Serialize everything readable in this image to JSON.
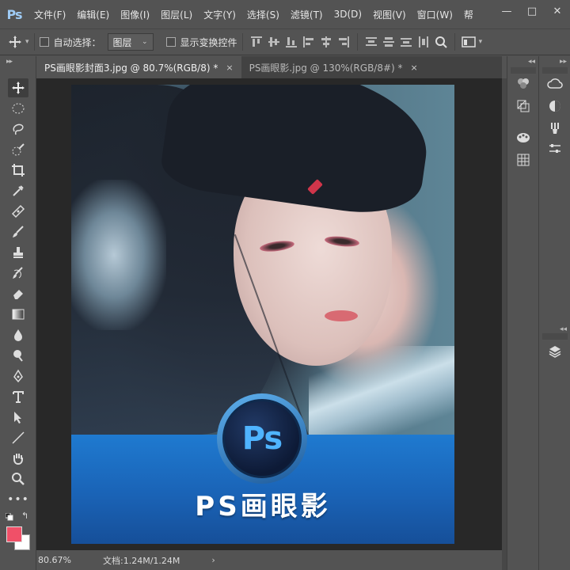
{
  "app": {
    "logo": "Ps"
  },
  "menu": {
    "items": [
      "文件(F)",
      "编辑(E)",
      "图像(I)",
      "图层(L)",
      "文字(Y)",
      "选择(S)",
      "滤镜(T)",
      "3D(D)",
      "视图(V)",
      "窗口(W)",
      "帮"
    ]
  },
  "window_controls": {
    "minimize": "—",
    "restore": "□",
    "close": "✕"
  },
  "options": {
    "auto_select_label": "自动选择：",
    "auto_select_value": "图层",
    "show_transform_label": "显示变换控件"
  },
  "tabs": [
    {
      "title": "PS画眼影封面3.jpg @ 80.7%(RGB/8) *",
      "close": "×",
      "active": true
    },
    {
      "title": "PS画眼影.jpg @ 130%(RGB/8#) *",
      "close": "×",
      "active": false
    }
  ],
  "tools": [
    "move-tool",
    "elliptical-marquee-tool",
    "lasso-tool",
    "quick-selection-tool",
    "crop-tool",
    "eyedropper-tool",
    "spot-healing-tool",
    "brush-tool",
    "clone-stamp-tool",
    "history-brush-tool",
    "eraser-tool",
    "gradient-tool",
    "blur-tool",
    "dodge-tool",
    "pen-tool",
    "type-tool",
    "path-selection-tool",
    "line-tool",
    "hand-tool",
    "zoom-tool",
    "more-tools"
  ],
  "colors": {
    "foreground": "#f05068",
    "background": "#ffffff",
    "accent_blue": "#1f7ad0",
    "ps_blue": "#4fb4ff"
  },
  "artwork": {
    "badge_text": "Ps",
    "banner_title": "PS画眼影"
  },
  "status": {
    "zoom": "80.67%",
    "doc_info": "文档:1.24M/1.24M",
    "arrow": "›"
  },
  "right_panels": {
    "col1": [
      "adjustments-icon",
      "styles-icon",
      "swatches-icon",
      "grid-icon"
    ],
    "col2": [
      "creative-cloud-icon",
      "color-icon",
      "brush-icon",
      "properties-icon",
      "layers-icon"
    ]
  }
}
